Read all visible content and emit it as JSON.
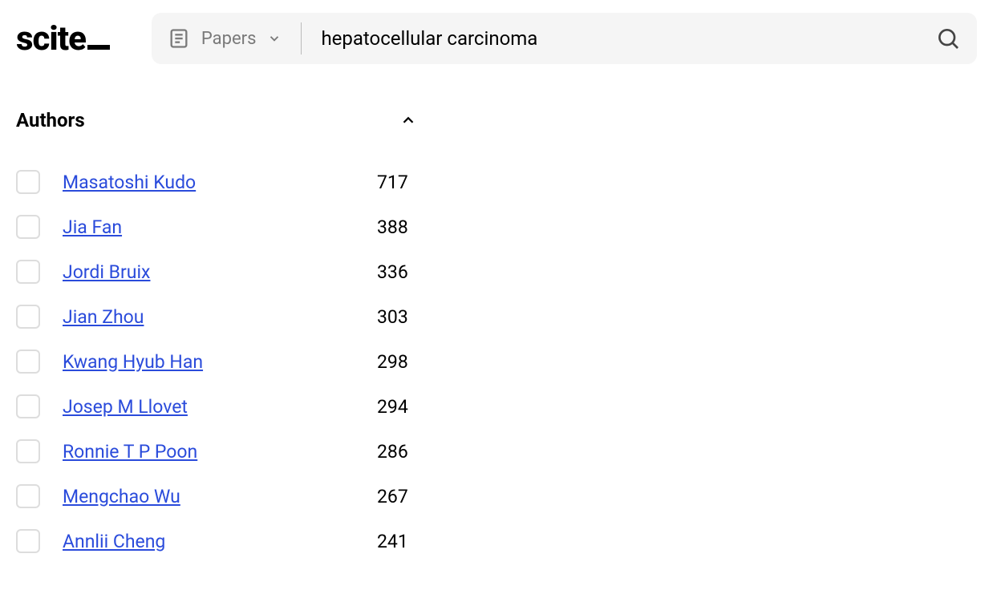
{
  "logo": {
    "text": "scite"
  },
  "search": {
    "type_label": "Papers",
    "query": "hepatocellular carcinoma"
  },
  "filter": {
    "title": "Authors",
    "authors": [
      {
        "name": "Masatoshi Kudo",
        "count": "717"
      },
      {
        "name": "Jia Fan",
        "count": "388"
      },
      {
        "name": "Jordi Bruix",
        "count": "336"
      },
      {
        "name": "Jian Zhou",
        "count": "303"
      },
      {
        "name": "Kwang Hyub Han",
        "count": "298"
      },
      {
        "name": "Josep M Llovet",
        "count": "294"
      },
      {
        "name": "Ronnie T P Poon",
        "count": "286"
      },
      {
        "name": "Mengchao Wu",
        "count": "267"
      },
      {
        "name": "Annlii Cheng",
        "count": "241"
      }
    ]
  }
}
